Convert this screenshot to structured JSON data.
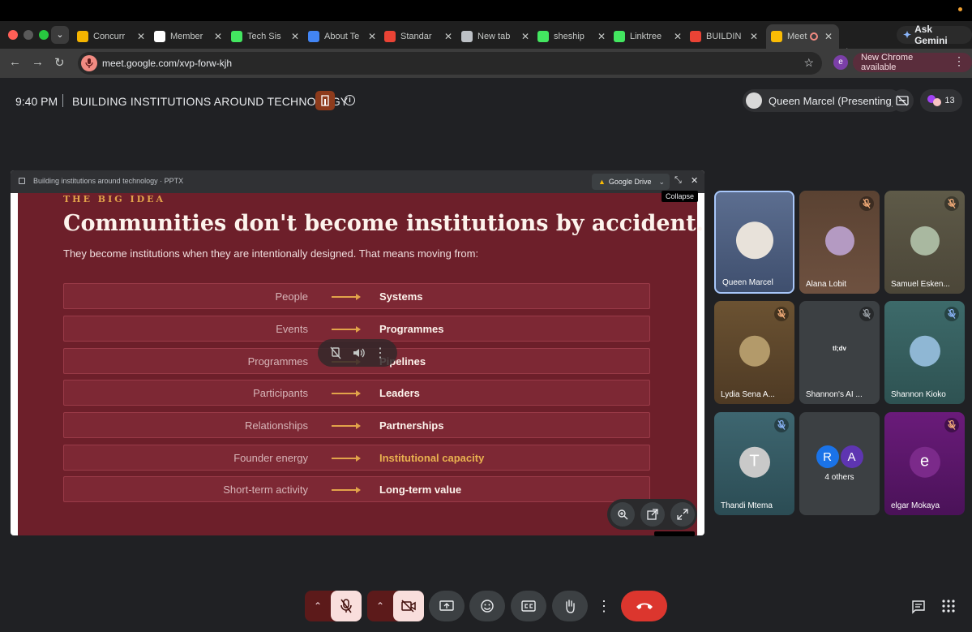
{
  "browser": {
    "tabs": [
      {
        "title": "Concurr",
        "favicon": "slides-icon",
        "color": "#f4b400"
      },
      {
        "title": "Member",
        "favicon": "github-icon",
        "color": "#ffffff"
      },
      {
        "title": "Tech Sis",
        "favicon": "linktree-icon",
        "color": "#43e660"
      },
      {
        "title": "About Te",
        "favicon": "docs-icon",
        "color": "#4285f4"
      },
      {
        "title": "Standar",
        "favicon": "gmail-icon",
        "color": "#ea4335"
      },
      {
        "title": "New tab",
        "favicon": "chrome-icon",
        "color": "#bdc1c6"
      },
      {
        "title": "sheship",
        "favicon": "linktree-icon",
        "color": "#43e660"
      },
      {
        "title": "Linktree",
        "favicon": "linktree-icon",
        "color": "#43e660"
      },
      {
        "title": "BUILDIN",
        "favicon": "gmail-icon",
        "color": "#ea4335"
      },
      {
        "title": "Meet",
        "favicon": "meet-icon",
        "color": "#fbbc04"
      }
    ],
    "ask_gemini": "Ask Gemini",
    "url": "meet.google.com/xvp-forw-kjh",
    "profile_initial": "e",
    "new_chrome": "New Chrome available"
  },
  "meet": {
    "time": "9:40 PM",
    "separator": "|",
    "title": "BUILDING INSTITUTIONS AROUND TECHNOLOGY",
    "presenter": "Queen Marcel (Presenting)",
    "participant_count": "13",
    "collapse_tooltip": "Collapse"
  },
  "presentation": {
    "file_name": "Building institutions around technology · PPTX",
    "open_with": "Google Drive",
    "kicker": "THE BIG IDEA",
    "headline": "Communities don't become institutions by accident.",
    "subtitle": "They become institutions when they are intentionally designed. That means moving from:",
    "rows": [
      {
        "from": "People",
        "to": "Systems"
      },
      {
        "from": "Events",
        "to": "Programmes"
      },
      {
        "from": "Programmes",
        "to": "Pipelines"
      },
      {
        "from": "Participants",
        "to": "Leaders"
      },
      {
        "from": "Relationships",
        "to": "Partnerships"
      },
      {
        "from": "Founder energy",
        "to": "Institutional capacity"
      },
      {
        "from": "Short-term activity",
        "to": "Long-term value"
      }
    ],
    "highlight_color": "#e9b14f"
  },
  "participants": [
    {
      "name": "Queen Marcel",
      "muted": false,
      "speaking": true
    },
    {
      "name": "Alana Lobit",
      "muted": true
    },
    {
      "name": "Samuel Esken...",
      "muted": true
    },
    {
      "name": "Lydia Sena A...",
      "muted": true
    },
    {
      "name": "Shannon's AI ...",
      "muted": true,
      "notetaker": "tl;dv"
    },
    {
      "name": "Shannon Kioko",
      "muted": true
    },
    {
      "name": "Thandi Mtema",
      "muted": true,
      "initial": "T"
    },
    {
      "name": "4 others",
      "initials": [
        "R",
        "A"
      ]
    },
    {
      "name": "elgar Mokaya",
      "muted": true,
      "initial": "e"
    }
  ]
}
